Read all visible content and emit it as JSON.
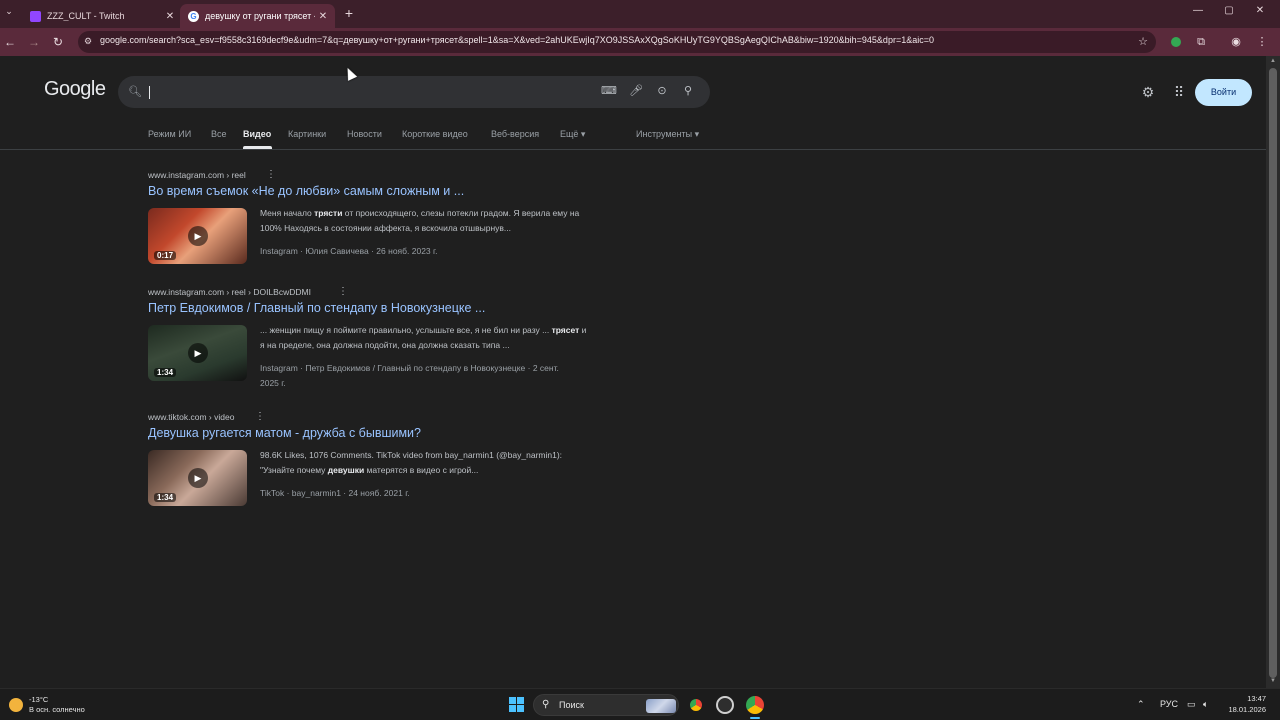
{
  "browser": {
    "tabs": [
      {
        "title": "ZZZ_CULT - Twitch",
        "active": false,
        "favicon_color": "#9146ff"
      },
      {
        "title": "девушку от ругани трясет - Пои",
        "active": true,
        "favicon_color": "#ffffff"
      }
    ],
    "url": "google.com/search?sca_esv=f9558c3169decf9e&udm=7&q=девушку+от+ругани+трясет&spell=1&sa=X&ved=2ahUKEwjIq7XO9JSSAxXQgSoKHUyTG9YQBSgAegQIChAB&biw=1920&bih=945&dpr=1&aic=0",
    "accent_color": "#5a2a3b"
  },
  "google": {
    "logo": "Google",
    "search_value": "",
    "signin_label": "Войти",
    "nav_tabs": [
      "Режим ИИ",
      "Все",
      "Видео",
      "Картинки",
      "Новости",
      "Короткие видео",
      "Веб-версия",
      "Ещё ▾"
    ],
    "active_tab": "Видео",
    "tools_label": "Инструменты ▾",
    "results": [
      {
        "cite": "www.instagram.com › reel",
        "title": "Во время съемок «Не до любви» самым сложным и ...",
        "duration": "0:17",
        "snippet_pre": "Меня начало ",
        "snippet_bold": "трясти",
        "snippet_post": " от происходящего, слезы потекли градом. Я верила ему на 100% Находясь в состоянии аффекта, я вскочила отшвырнув...",
        "meta": "Instagram · Юлия Савичева · 26 нояб. 2023 г."
      },
      {
        "cite": "www.instagram.com › reel › DOILBcwDDMI",
        "title": "Петр Евдокимов / Главный по стендапу в Новокузнецке ...",
        "duration": "1:34",
        "snippet_pre": "... женщин пищу я поймите правильно, услышьте все, я не бил ни разу ... ",
        "snippet_bold": "трясет",
        "snippet_post": " и я на пределе, она должна подойти, она должна сказать типа ...",
        "meta": "Instagram · Петр Евдокимов / Главный по стендапу в Новокузнецке · 2 сент. 2025 г."
      },
      {
        "cite": "www.tiktok.com › video",
        "title": "Девушка ругается матом - дружба с бывшими?",
        "duration": "1:34",
        "snippet_pre": "98.6K Likes, 1076 Comments. TikTok video from bay_narmin1 (@bay_narmin1): \"Узнайте почему ",
        "snippet_bold": "девушки",
        "snippet_post": " матерятся в видео с игрой...",
        "meta": "TikTok · bay_narmin1 · 24 нояб. 2021 г."
      }
    ]
  },
  "taskbar": {
    "temperature": "-13°C",
    "weather": "В осн. солнечно",
    "search_label": "Поиск",
    "language": "РУС",
    "time": "13:47",
    "date": "18.01.2026"
  }
}
